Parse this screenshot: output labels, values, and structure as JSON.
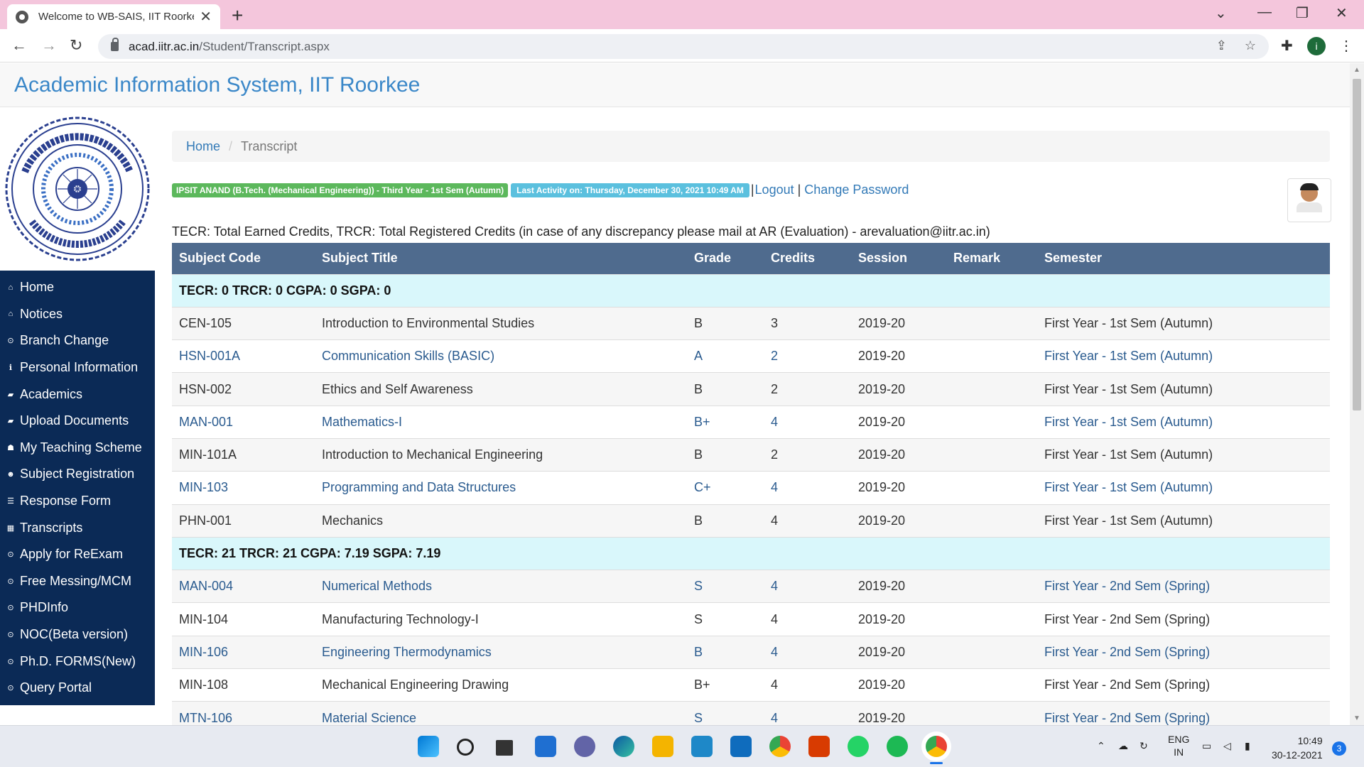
{
  "browser": {
    "tab_title": "Welcome to WB-SAIS, IIT Roorke",
    "url_host": "acad.iitr.ac.in",
    "url_path": "/Student/Transcript.aspx",
    "profile_initial": "i"
  },
  "page": {
    "site_title": "Academic Information System, IIT Roorkee",
    "breadcrumb": {
      "home": "Home",
      "current": "Transcript"
    },
    "student_badge": "IPSIT ANAND (B.Tech. (Mechanical Engineering)) - Third Year - 1st Sem (Autumn)",
    "activity_badge": "Last Activity on: Thursday, December 30, 2021 10:49 AM",
    "logout": "Logout",
    "separator": "|",
    "change_password": "Change Password",
    "note": "TECR: Total Earned Credits, TRCR: Total Registered Credits (in case of any discrepancy please mail at AR (Evaluation) - arevaluation@iitr.ac.in)"
  },
  "sidebar": {
    "items": [
      {
        "label": "Home",
        "icon": "home-icon",
        "glyph": "⌂"
      },
      {
        "label": "Notices",
        "icon": "home-icon",
        "glyph": "⌂"
      },
      {
        "label": "Branch Change",
        "icon": "circle-icon",
        "glyph": "⊙"
      },
      {
        "label": "Personal Information",
        "icon": "info-icon",
        "glyph": "ℹ"
      },
      {
        "label": "Academics",
        "icon": "book-icon",
        "glyph": "▰"
      },
      {
        "label": "Upload Documents",
        "icon": "book-icon",
        "glyph": "▰"
      },
      {
        "label": "My Teaching Scheme",
        "icon": "graduation-cap-icon",
        "glyph": "☗"
      },
      {
        "label": "Subject Registration",
        "icon": "group-icon",
        "glyph": "☻"
      },
      {
        "label": "Response Form",
        "icon": "list-icon",
        "glyph": "☰"
      },
      {
        "label": "Transcripts",
        "icon": "table-icon",
        "glyph": "▦"
      },
      {
        "label": "Apply for ReExam",
        "icon": "circle-icon",
        "glyph": "⊙"
      },
      {
        "label": "Free Messing/MCM",
        "icon": "circle-icon",
        "glyph": "⊙"
      },
      {
        "label": "PHDInfo",
        "icon": "circle-icon",
        "glyph": "⊙"
      },
      {
        "label": "NOC(Beta version)",
        "icon": "circle-icon",
        "glyph": "⊙"
      },
      {
        "label": "Ph.D. FORMS(New)",
        "icon": "circle-icon",
        "glyph": "⊙"
      },
      {
        "label": "Query Portal",
        "icon": "circle-icon",
        "glyph": "⊙"
      }
    ]
  },
  "table": {
    "headers": [
      "Subject Code",
      "Subject Title",
      "Grade",
      "Credits",
      "Session",
      "Remark",
      "Semester"
    ],
    "rows": [
      {
        "type": "summary",
        "text": "TECR: 0 TRCR: 0 CGPA: 0 SGPA: 0"
      },
      {
        "type": "row",
        "link": false,
        "cells": [
          "CEN-105",
          "Introduction to Environmental Studies",
          "B",
          "3",
          "2019-20",
          "",
          "First Year - 1st Sem (Autumn)"
        ]
      },
      {
        "type": "row",
        "link": true,
        "cells": [
          "HSN-001A",
          "Communication Skills (BASIC)",
          "A",
          "2",
          "2019-20",
          "",
          "First Year - 1st Sem (Autumn)"
        ]
      },
      {
        "type": "row",
        "link": false,
        "cells": [
          "HSN-002",
          "Ethics and Self Awareness",
          "B",
          "2",
          "2019-20",
          "",
          "First Year - 1st Sem (Autumn)"
        ]
      },
      {
        "type": "row",
        "link": true,
        "cells": [
          "MAN-001",
          "Mathematics-I",
          "B+",
          "4",
          "2019-20",
          "",
          "First Year - 1st Sem (Autumn)"
        ]
      },
      {
        "type": "row",
        "link": false,
        "cells": [
          "MIN-101A",
          "Introduction to Mechanical Engineering",
          "B",
          "2",
          "2019-20",
          "",
          "First Year - 1st Sem (Autumn)"
        ]
      },
      {
        "type": "row",
        "link": true,
        "cells": [
          "MIN-103",
          "Programming and Data Structures",
          "C+",
          "4",
          "2019-20",
          "",
          "First Year - 1st Sem (Autumn)"
        ]
      },
      {
        "type": "row",
        "link": false,
        "cells": [
          "PHN-001",
          "Mechanics",
          "B",
          "4",
          "2019-20",
          "",
          "First Year - 1st Sem (Autumn)"
        ]
      },
      {
        "type": "summary",
        "text": "TECR: 21 TRCR: 21 CGPA: 7.19 SGPA: 7.19"
      },
      {
        "type": "row",
        "link": true,
        "cells": [
          "MAN-004",
          "Numerical Methods",
          "S",
          "4",
          "2019-20",
          "",
          "First Year - 2nd Sem (Spring)"
        ]
      },
      {
        "type": "row",
        "link": false,
        "cells": [
          "MIN-104",
          "Manufacturing Technology-I",
          "S",
          "4",
          "2019-20",
          "",
          "First Year - 2nd Sem (Spring)"
        ]
      },
      {
        "type": "row",
        "link": true,
        "cells": [
          "MIN-106",
          "Engineering Thermodynamics",
          "B",
          "4",
          "2019-20",
          "",
          "First Year - 2nd Sem (Spring)"
        ]
      },
      {
        "type": "row",
        "link": false,
        "cells": [
          "MIN-108",
          "Mechanical Engineering Drawing",
          "B+",
          "4",
          "2019-20",
          "",
          "First Year - 2nd Sem (Spring)"
        ]
      },
      {
        "type": "row",
        "link": true,
        "cells": [
          "MTN-106",
          "Material Science",
          "S",
          "4",
          "2019-20",
          "",
          "First Year - 2nd Sem (Spring)"
        ]
      }
    ]
  },
  "taskbar": {
    "lang_top": "ENG",
    "lang_bottom": "IN",
    "time": "10:49",
    "date": "30-12-2021",
    "notification_count": "3"
  },
  "colors": {
    "nav_bg": "#0b2a56",
    "table_header": "#4f6b8e",
    "summary_row": "#d9f7fb",
    "link": "#2a5b8f",
    "badge_green": "#5cb85c",
    "badge_blue": "#5bc0de"
  }
}
